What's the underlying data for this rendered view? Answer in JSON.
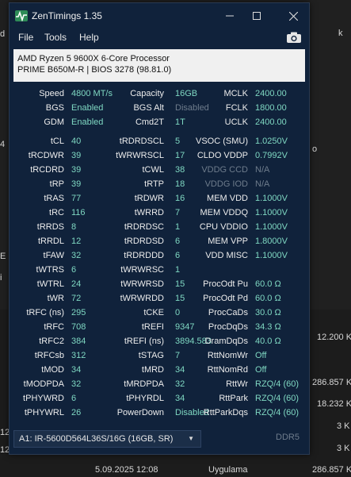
{
  "window": {
    "title": "ZenTimings 1.35"
  },
  "menu": {
    "file": "File",
    "tools": "Tools",
    "help": "Help"
  },
  "cpu": {
    "name": "AMD Ryzen 5 9600X 6-Core Processor",
    "board": "PRIME B650M-R | BIOS 3278 (98.81.0)"
  },
  "summary": [
    [
      "Speed",
      "4800 MT/s",
      "Capacity",
      "16GB",
      "MCLK",
      "2400.00"
    ],
    [
      "BGS",
      "Enabled",
      "BGS Alt",
      "Disabled",
      "FCLK",
      "1800.00"
    ],
    [
      "GDM",
      "Enabled",
      "Cmd2T",
      "1T",
      "UCLK",
      "2400.00"
    ]
  ],
  "timings": [
    [
      "tCL",
      "40",
      "tRDRDSCL",
      "5",
      "VSOC (SMU)",
      "1.0250V"
    ],
    [
      "tRCDWR",
      "39",
      "tWRWRSCL",
      "17",
      "CLDO VDDP",
      "0.7992V"
    ],
    [
      "tRCDRD",
      "39",
      "tCWL",
      "38",
      "VDDG CCD",
      "N/A"
    ],
    [
      "tRP",
      "39",
      "tRTP",
      "18",
      "VDDG IOD",
      "N/A"
    ],
    [
      "tRAS",
      "77",
      "tRDWR",
      "16",
      "MEM VDD",
      "1.1000V"
    ],
    [
      "tRC",
      "116",
      "tWRRD",
      "7",
      "MEM VDDQ",
      "1.1000V"
    ],
    [
      "tRRDS",
      "8",
      "tRDRDSC",
      "1",
      "CPU VDDIO",
      "1.1000V"
    ],
    [
      "tRRDL",
      "12",
      "tRDRDSD",
      "6",
      "MEM VPP",
      "1.8000V"
    ],
    [
      "tFAW",
      "32",
      "tRDRDDD",
      "6",
      "VDD MISC",
      "1.1000V"
    ],
    [
      "tWTRS",
      "6",
      "tWRWRSC",
      "1",
      "",
      ""
    ],
    [
      "tWTRL",
      "24",
      "tWRWRSD",
      "15",
      "ProcOdt Pu",
      "60.0 Ω"
    ],
    [
      "tWR",
      "72",
      "tWRWRDD",
      "15",
      "ProcOdt Pd",
      "60.0 Ω"
    ],
    [
      "tRFC (ns)",
      "295",
      "tCKE",
      "0",
      "ProcCaDs",
      "30.0 Ω"
    ],
    [
      "tRFC",
      "708",
      "tREFI",
      "9347",
      "ProcDqDs",
      "34.3 Ω"
    ],
    [
      "tRFC2",
      "384",
      "tREFI (ns)",
      "3894.583",
      "DramDqDs",
      "40.0 Ω"
    ],
    [
      "tRFCsb",
      "312",
      "tSTAG",
      "7",
      "RttNomWr",
      "Off"
    ],
    [
      "tMOD",
      "34",
      "tMRD",
      "34",
      "RttNomRd",
      "Off"
    ],
    [
      "tMODPDA",
      "32",
      "tMRDPDA",
      "32",
      "RttWr",
      "RZQ/4 (60)"
    ],
    [
      "tPHYWRD",
      "6",
      "tPHYRDL",
      "34",
      "RttPark",
      "RZQ/4 (60)"
    ],
    [
      "tPHYWRL",
      "26",
      "PowerDown",
      "Disabled",
      "RttParkDqs",
      "RZQ/4 (60)"
    ]
  ],
  "dimm": {
    "selected": "A1: IR-5600D564L36S/16G (16GB, SR)",
    "type": "DDR5"
  },
  "background": {
    "frag_d": "d",
    "frag_4": "4",
    "frag_k": "k",
    "frag_o": "o",
    "frag_e": "E",
    "frag_i": "i",
    "frag_12a": "12",
    "frag_12b": "12",
    "size1": "12.200 K",
    "size2": "286.857 K",
    "size3": "18.232 K",
    "size4": "3 K",
    "size5": "3 K",
    "size6": "286.857 K",
    "date": "5.09.2025 12:08",
    "kind": "Uygulama"
  },
  "colors": {
    "window_bg": "#10223b",
    "value": "#7fd8c2",
    "dim": "#6e7c8c"
  }
}
